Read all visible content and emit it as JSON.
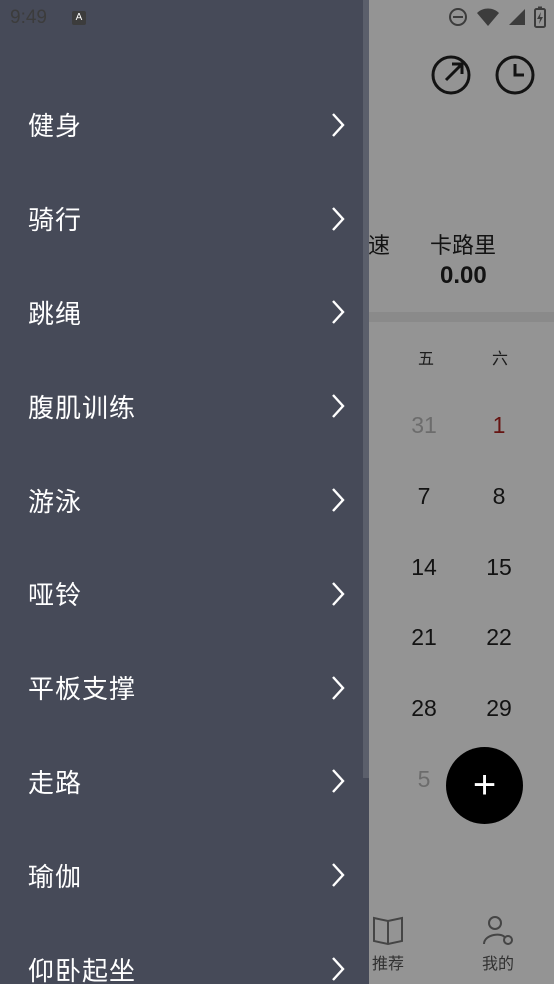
{
  "status_bar": {
    "time": "9:49",
    "a_badge": "A"
  },
  "drawer": {
    "items": [
      {
        "label": "健身"
      },
      {
        "label": "骑行"
      },
      {
        "label": "跳绳"
      },
      {
        "label": "腹肌训练"
      },
      {
        "label": "游泳"
      },
      {
        "label": "哑铃"
      },
      {
        "label": "平板支撑"
      },
      {
        "label": "走路"
      },
      {
        "label": "瑜伽"
      },
      {
        "label": "仰卧起坐"
      }
    ]
  },
  "background": {
    "stats": {
      "speed_label_partial": "速",
      "calorie_label": "卡路里",
      "calorie_value": "0.00"
    },
    "calendar": {
      "weekday_fri": "五",
      "weekday_sat": "六",
      "rows": [
        {
          "fri": "31",
          "sat": "1"
        },
        {
          "fri": "7",
          "sat": "8"
        },
        {
          "fri": "14",
          "sat": "15"
        },
        {
          "fri": "21",
          "sat": "22"
        },
        {
          "fri": "28",
          "sat": "29"
        },
        {
          "fri": "5",
          "sat": ""
        }
      ]
    },
    "fab_symbol": "+",
    "nav": {
      "recommend": "推荐",
      "mine": "我的"
    },
    "colors": {
      "drawer_bg": "#464a58",
      "scrim": "rgba(0,0,0,0.42)",
      "accent_red": "#b0231f"
    }
  }
}
